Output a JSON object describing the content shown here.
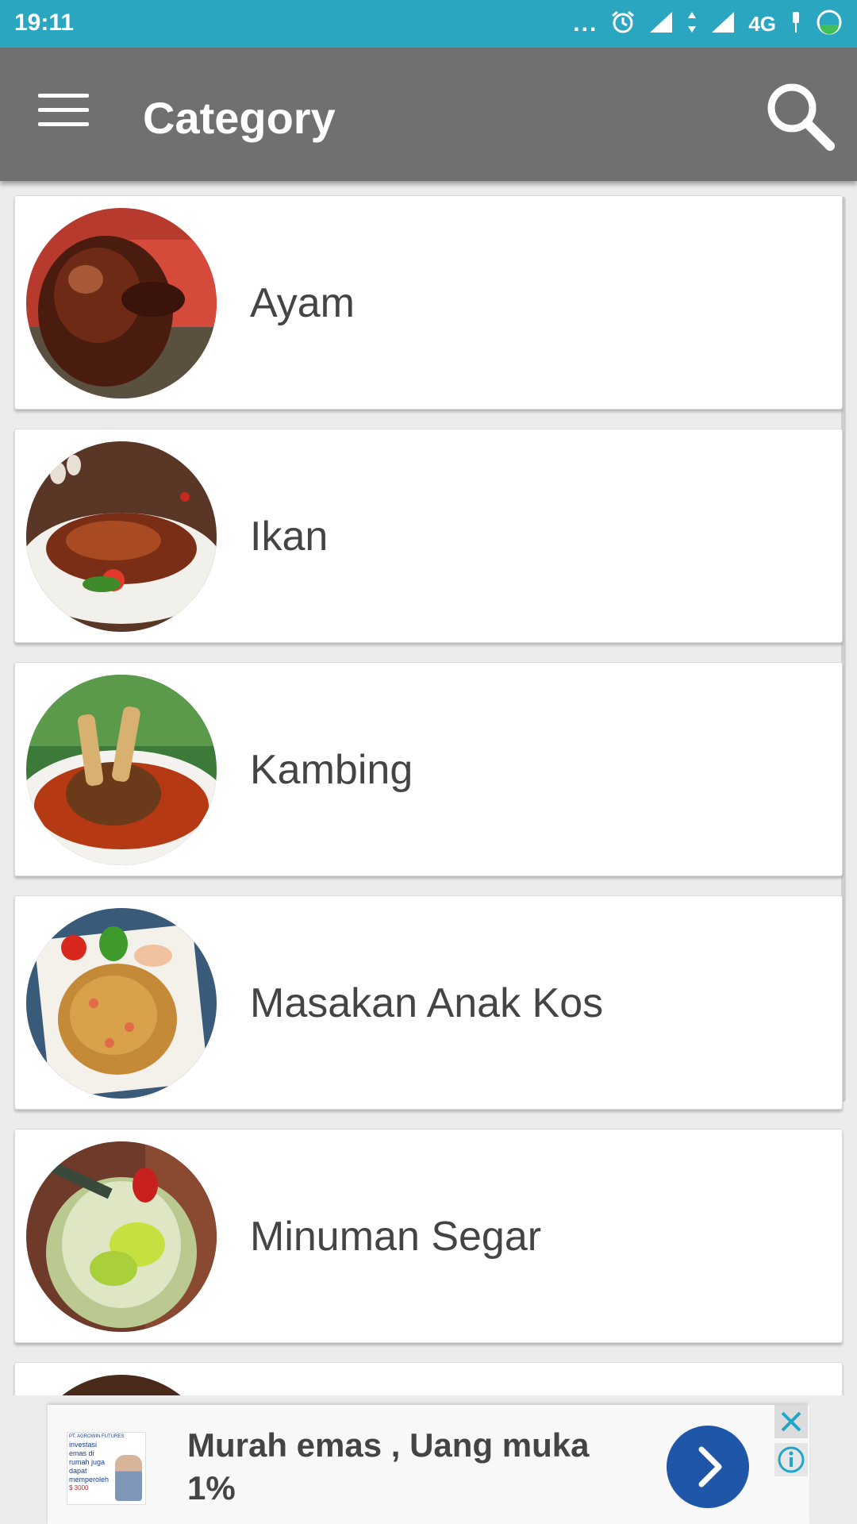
{
  "status_bar": {
    "time": "19:11",
    "dots": "...",
    "network": "4G",
    "color": "#2aa6c1"
  },
  "toolbar": {
    "title": "Category",
    "menu_icon": "hamburger-icon",
    "search_icon": "search-icon",
    "color": "#707070"
  },
  "categories": [
    {
      "label": "Ayam",
      "icon": "fried-chicken-thumbnail"
    },
    {
      "label": "Ikan",
      "icon": "grilled-fish-thumbnail"
    },
    {
      "label": "Kambing",
      "icon": "lamb-curry-thumbnail"
    },
    {
      "label": "Masakan Anak Kos",
      "icon": "fried-rice-thumbnail"
    },
    {
      "label": "Minuman Segar",
      "icon": "fresh-drink-thumbnail"
    }
  ],
  "ad": {
    "headline": "Murah emas , Uang muka 1%",
    "thumb_header": "PT. AGROWIN FUTURES",
    "thumb_text": "investasi emas di rumah juga dapat memperoleh",
    "thumb_price": "$ 3000",
    "accent": "#1f56a8"
  }
}
